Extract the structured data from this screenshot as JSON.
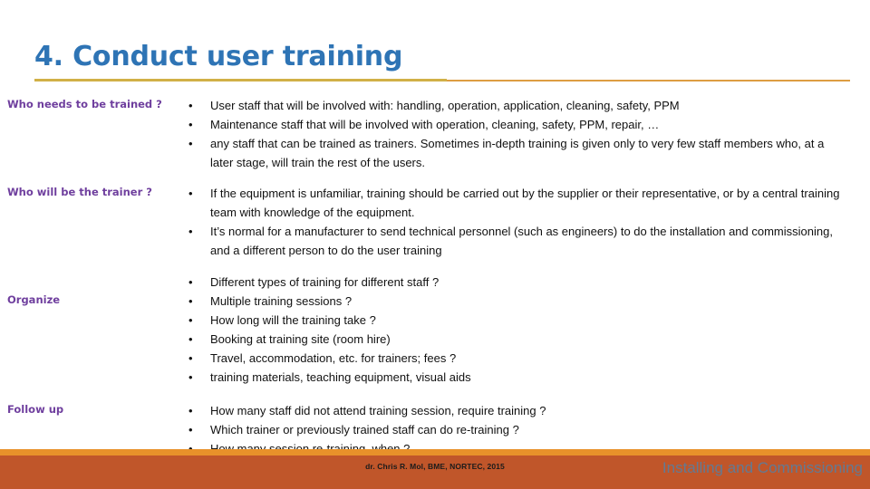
{
  "slide": {
    "title": "4.  Conduct user training",
    "title_color": "#2E74B5",
    "label_color": "#6F3F9E",
    "rule_color_left": "#C9A227",
    "rule_color_right": "#D9922E",
    "bullet_glyph": "•"
  },
  "sections": [
    {
      "label": "Who needs to be trained ?",
      "bullets": [
        "User staff that will be involved with:  handling, operation, application, cleaning, safety, PPM",
        "Maintenance staff that will be involved with operation, cleaning, safety, PPM, repair, …",
        "any staff that can be trained as trainers.  Sometimes in-depth training is given only to very few staff members who, at a later stage, will train the rest of the users."
      ]
    },
    {
      "label": "Who will be the trainer ?",
      "bullets": [
        "If the equipment is unfamiliar, training should be carried out by the supplier or their representative, or by a central training team with knowledge of the equipment.",
        "It’s normal for a manufacturer to send technical personnel (such as engineers) to do the installation and commissioning, and a different person to do the user training"
      ]
    },
    {
      "label": "Organize",
      "bullets": [
        "Different types of training for different staff ?",
        "Multiple training sessions ?",
        "How long will the training take ?",
        "Booking at training site (room hire)",
        "Travel, accommodation, etc. for trainers; fees ?",
        "training materials, teaching equipment, visual aids"
      ]
    },
    {
      "label": "Follow up",
      "bullets": [
        "How many staff did not attend training session, require training ?",
        "Which trainer or previously trained staff can do re-training ?",
        "How many session re-training, when ?"
      ]
    }
  ],
  "footer": {
    "citation": "dr. Chris R. Mol, BME, NORTEC, 2015",
    "deck_title": "Installing and Commissioning",
    "accent_color": "#E8912A",
    "bar_color": "#C0562A",
    "deck_title_color": "#5E7C99"
  }
}
